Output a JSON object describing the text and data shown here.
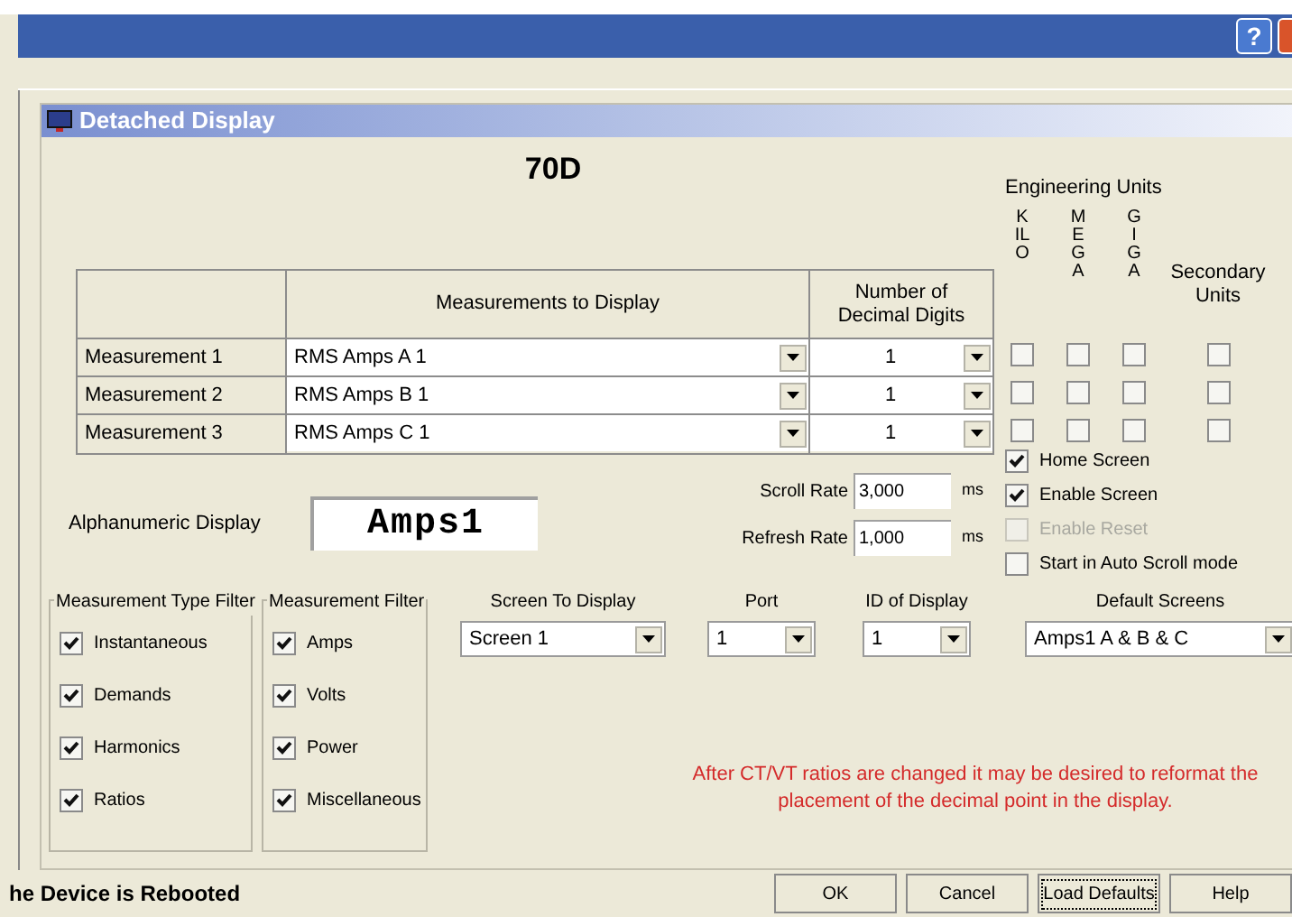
{
  "window": {
    "help_glyph": "?"
  },
  "dialog": {
    "title": "Detached Display"
  },
  "device_title": "70D",
  "table": {
    "columns": [
      "Measurements to Display",
      "Number of Decimal Digits"
    ],
    "rows": [
      {
        "label": "Measurement 1",
        "measurement": "RMS Amps A 1",
        "decimal_digits": "1",
        "kilo": false,
        "mega": false,
        "giga": false,
        "secondary": false
      },
      {
        "label": "Measurement 2",
        "measurement": "RMS Amps B 1",
        "decimal_digits": "1",
        "kilo": false,
        "mega": false,
        "giga": false,
        "secondary": false
      },
      {
        "label": "Measurement 3",
        "measurement": "RMS Amps C 1",
        "decimal_digits": "1",
        "kilo": false,
        "mega": false,
        "giga": false,
        "secondary": false
      }
    ]
  },
  "engineering_units": {
    "title": "Engineering Units",
    "columns": [
      "KILO",
      "MEGA",
      "GIGA"
    ],
    "secondary": "Secondary Units"
  },
  "alphanumeric": {
    "label": "Alphanumeric Display",
    "value": "Amps1"
  },
  "rates": [
    {
      "label": "Scroll Rate",
      "value": "3,000",
      "unit": "ms"
    },
    {
      "label": "Refresh Rate",
      "value": "1,000",
      "unit": "ms"
    }
  ],
  "options": [
    {
      "label": "Home Screen",
      "checked": true,
      "disabled": false
    },
    {
      "label": "Enable Screen",
      "checked": true,
      "disabled": false
    },
    {
      "label": "Enable Reset",
      "checked": false,
      "disabled": true
    },
    {
      "label": "Start in Auto Scroll mode",
      "checked": false,
      "disabled": false
    }
  ],
  "type_filter": {
    "title": "Measurement Type Filter",
    "items": [
      {
        "label": "Instantaneous",
        "checked": true
      },
      {
        "label": "Demands",
        "checked": true
      },
      {
        "label": "Harmonics",
        "checked": true
      },
      {
        "label": "Ratios",
        "checked": true
      }
    ]
  },
  "measurement_filter": {
    "title": "Measurement Filter",
    "items": [
      {
        "label": "Amps",
        "checked": true
      },
      {
        "label": "Volts",
        "checked": true
      },
      {
        "label": "Power",
        "checked": true
      },
      {
        "label": "Miscellaneous",
        "checked": true
      }
    ]
  },
  "selectors": [
    {
      "label": "Screen To Display",
      "value": "Screen 1"
    },
    {
      "label": "Port",
      "value": "1"
    },
    {
      "label": "ID of Display",
      "value": "1"
    },
    {
      "label": "Default Screens",
      "value": "Amps1 A & B & C"
    }
  ],
  "note": "After CT/VT ratios are changed it may be desired to reformat the placement of the decimal point in the display.",
  "status_text": "he Device is Rebooted",
  "buttons": [
    {
      "label": "OK",
      "focused": false
    },
    {
      "label": "Cancel",
      "focused": false
    },
    {
      "label": "Load Defaults",
      "focused": true
    },
    {
      "label": "Help",
      "focused": false
    }
  ]
}
